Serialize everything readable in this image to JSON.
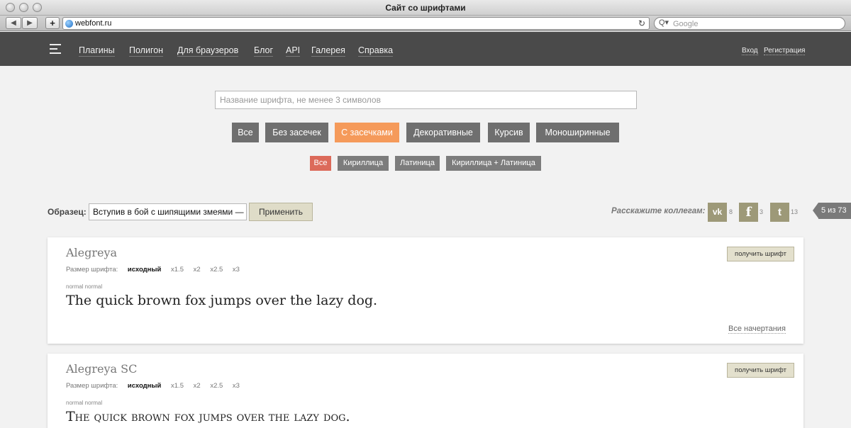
{
  "window": {
    "title": "Сайт со шрифтами"
  },
  "browser": {
    "url": "webfont.ru",
    "search_placeholder": "Google",
    "back_icon": "◀",
    "forward_icon": "▶",
    "add_icon": "+",
    "reload_icon": "↻",
    "search_icon": "Q▾"
  },
  "nav": {
    "links": [
      "Плагины",
      "Полигон",
      "Для браузеров",
      "Блог",
      "API",
      "Галерея",
      "Справка"
    ],
    "login": "Вход",
    "register": "Регистрация"
  },
  "search": {
    "placeholder": "Название шрифта, не менее 3 символов"
  },
  "categories": {
    "items": [
      "Все",
      "Без засечек",
      "С засечками",
      "Декоративные",
      "Курсив",
      "Моноширинные"
    ],
    "active": "С засечками"
  },
  "languages": {
    "items": [
      "Все",
      "Кириллица",
      "Латиница",
      "Кириллица + Латиница"
    ],
    "active": "Все"
  },
  "sample": {
    "label": "Образец:",
    "value": "Вступив в бой с шипящими змеями —",
    "apply": "Применить"
  },
  "share": {
    "label": "Расскажите коллегам:",
    "networks": [
      {
        "icon": "vk-icon",
        "glyph": "vk",
        "count": "8"
      },
      {
        "icon": "facebook-icon",
        "glyph": "f",
        "count": "3"
      },
      {
        "icon": "twitter-icon",
        "glyph": "t",
        "count": "13"
      }
    ]
  },
  "pager": {
    "text": "5 из 73"
  },
  "fonts": [
    {
      "name": "Alegreya",
      "size_label": "Размер шрифта:",
      "sizes": [
        "исходный",
        "x1.5",
        "x2",
        "x2.5",
        "x3"
      ],
      "selected_size": "исходный",
      "style": "normal normal",
      "specimen": "The quick brown fox jumps over the lazy dog.",
      "get_button": "получить шрифт",
      "all_styles": "Все начертания"
    },
    {
      "name": "Alegreya SC",
      "size_label": "Размер шрифта:",
      "sizes": [
        "исходный",
        "x1.5",
        "x2",
        "x2.5",
        "x3"
      ],
      "selected_size": "исходный",
      "style": "normal normal",
      "specimen": "The quick brown fox jumps over the lazy dog.",
      "get_button": "получить шрифт"
    }
  ],
  "colors": {
    "nav_bg": "#4a4a4a",
    "category_bg": "#6f6f6f",
    "category_active": "#f59a5a",
    "language_active": "#dc6a5a",
    "social_bg": "#9d9978"
  }
}
